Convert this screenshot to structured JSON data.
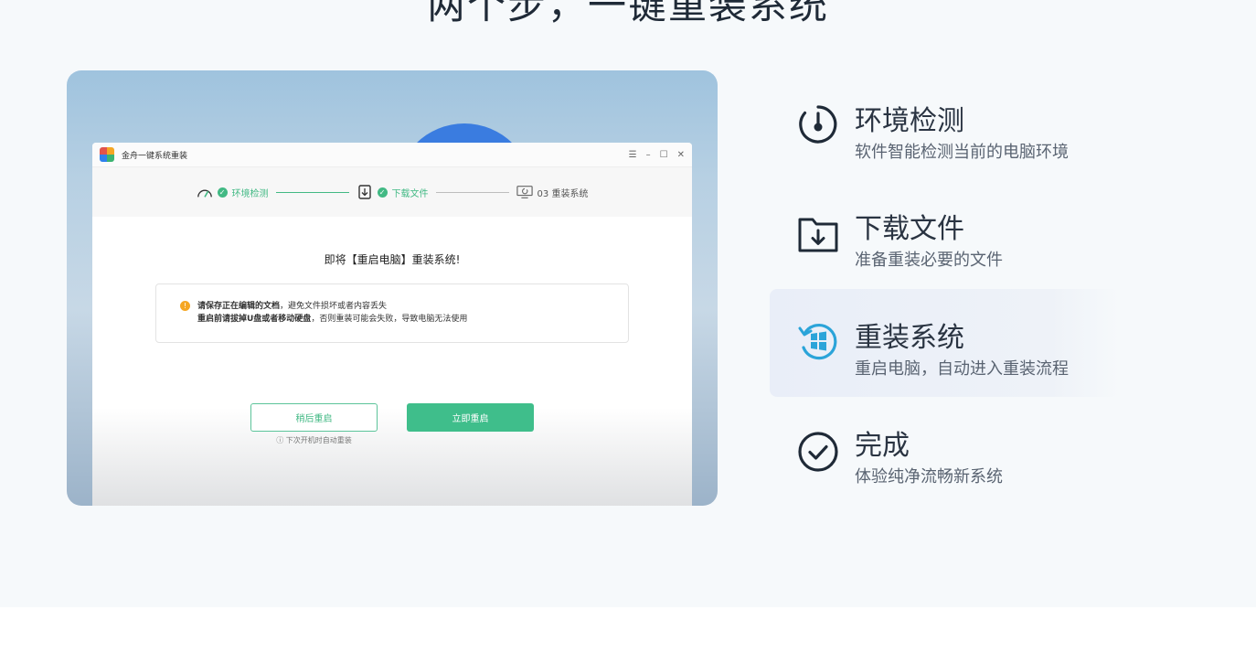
{
  "headline": "两个步，一键重装系统",
  "app": {
    "title": "金舟一键系统重装",
    "controls": {
      "menu": "☰",
      "minimize": "–",
      "maximize": "☐",
      "close": "✕"
    }
  },
  "stepper": {
    "steps": [
      {
        "label": "环境检测"
      },
      {
        "label": "下载文件"
      },
      {
        "label": "03 重装系统"
      }
    ]
  },
  "notice": {
    "title": "即将【重启电脑】重装系统!",
    "line1_bold": "请保存正在编辑的文档",
    "line1_rest": "，避免文件损坏或者内容丢失",
    "line2_bold": "重启前请拔掉U盘或者移动硬盘",
    "line2_rest": "，否则重装可能会失败，导致电脑无法使用"
  },
  "buttons": {
    "later": "稍后重启",
    "now": "立即重启",
    "hint": "ⓘ 下次开机时自动重装"
  },
  "features": [
    {
      "title": "环境检测",
      "desc": "软件智能检测当前的电脑环境",
      "icon": "gauge-icon"
    },
    {
      "title": "下载文件",
      "desc": "准备重装必要的文件",
      "icon": "folder-download-icon"
    },
    {
      "title": "重装系统",
      "desc": "重启电脑，自动进入重装流程",
      "icon": "windows-restore-icon",
      "active": true
    },
    {
      "title": "完成",
      "desc": "体验纯净流畅新系统",
      "icon": "check-circle-icon"
    }
  ],
  "colors": {
    "accent": "#42b984",
    "warn": "#f5a623",
    "blue_icon": "#2ba4d9",
    "dark": "#1f2a37"
  }
}
